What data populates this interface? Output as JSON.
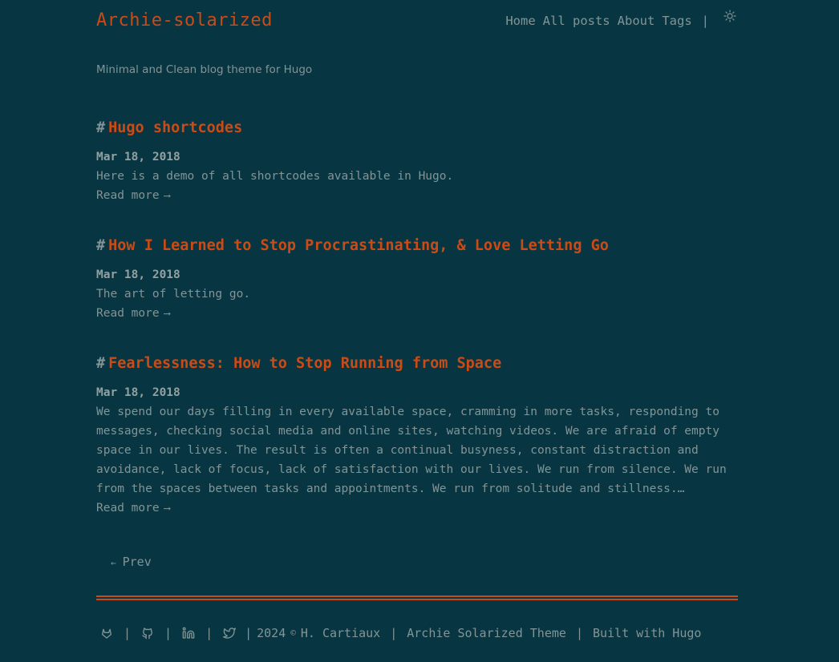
{
  "header": {
    "site_title": "Archie-solarized",
    "nav": [
      {
        "label": "Home"
      },
      {
        "label": "All posts"
      },
      {
        "label": "About"
      },
      {
        "label": "Tags"
      }
    ],
    "separator": "|",
    "theme_toggle_icon": "sun-icon"
  },
  "tagline": "Minimal and Clean blog theme for Hugo",
  "posts": [
    {
      "hash": "#",
      "title": "Hugo shortcodes",
      "date": "Mar 18, 2018",
      "summary": "Here is a demo of all shortcodes available in Hugo.",
      "read_more": "Read more",
      "arrow": "⟶"
    },
    {
      "hash": "#",
      "title": "How I Learned to Stop Procrastinating, & Love Letting Go",
      "date": "Mar 18, 2018",
      "summary": "The art of letting go.",
      "read_more": "Read more",
      "arrow": "⟶"
    },
    {
      "hash": "#",
      "title": "Fearlessness: How to Stop Running from Space",
      "date": "Mar 18, 2018",
      "summary": "We spend our days filling in every available space, cramming in more tasks, responding to messages, checking social media and online sites, watching videos. We are afraid of empty space in our lives. The result is often a continual busyness, constant distraction and avoidance, lack of focus, lack of satisfaction with our lives. We run from silence. We run from the spaces between tasks and appointments. We run from solitude and stillness.…",
      "read_more": "Read more",
      "arrow": "⟶"
    }
  ],
  "pagination": {
    "prev_arrow": "←",
    "prev_label": "Prev"
  },
  "footer": {
    "icons": [
      "gitlab-icon",
      "github-icon",
      "linkedin-icon",
      "twitter-icon"
    ],
    "pipe": "|",
    "year": "2024",
    "copyright_symbol": "©",
    "author": "H. Cartiaux",
    "theme_link": "Archie Solarized Theme",
    "built_with": "Built with Hugo"
  },
  "colors": {
    "background": "#073642",
    "accent": "#cb4b16",
    "text": "#839496"
  }
}
